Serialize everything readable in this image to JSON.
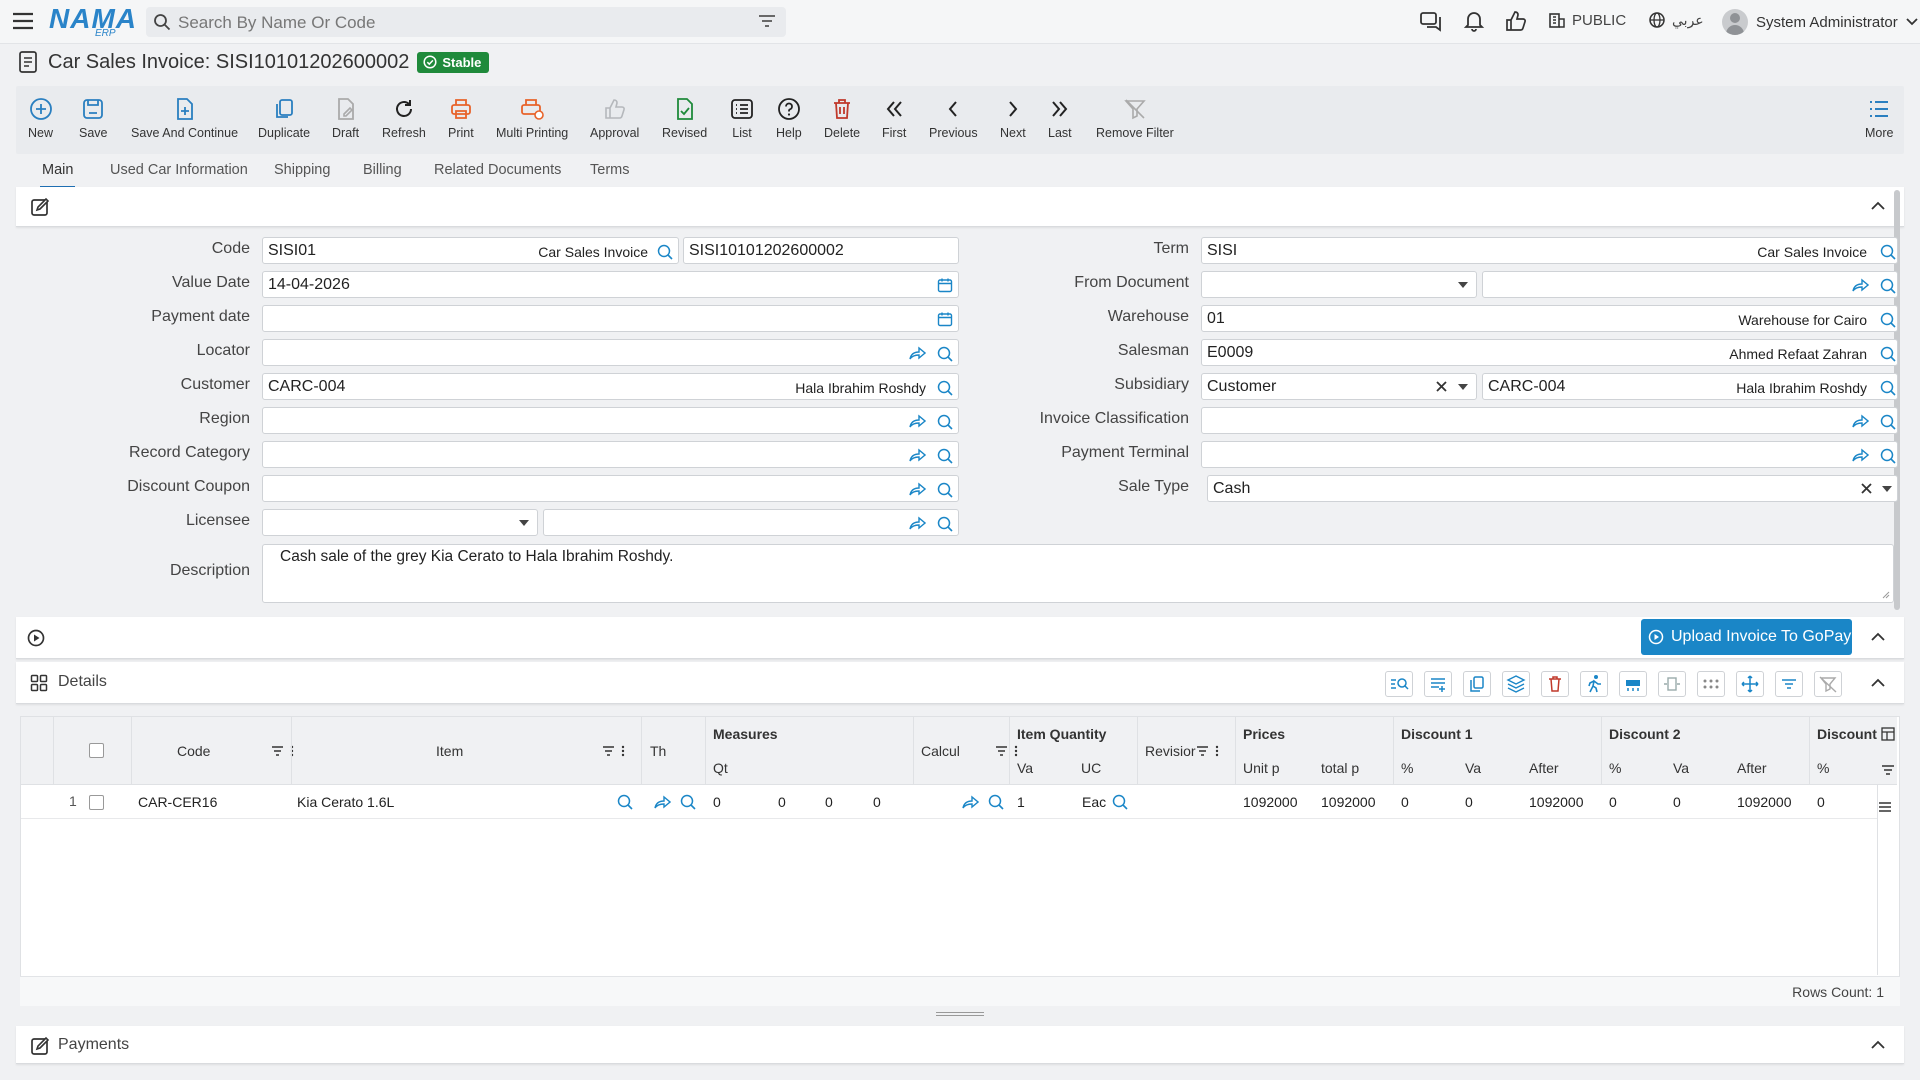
{
  "topbar": {
    "logo_main": "NAMA",
    "logo_sub": "ERP",
    "search_placeholder": "Search By Name Or Code",
    "public_label": "PUBLIC",
    "language_label": "عربي",
    "user_name": "System Administrator"
  },
  "page": {
    "title": "Car Sales Invoice: SISI10101202600002",
    "status": "Stable"
  },
  "toolbar": {
    "new": "New",
    "save": "Save",
    "save_continue": "Save And Continue",
    "duplicate": "Duplicate",
    "draft": "Draft",
    "refresh": "Refresh",
    "print": "Print",
    "multi_printing": "Multi Printing",
    "approval": "Approval",
    "revised": "Revised",
    "list": "List",
    "help": "Help",
    "delete": "Delete",
    "first": "First",
    "previous": "Previous",
    "next": "Next",
    "last": "Last",
    "remove_filter": "Remove Filter",
    "more": "More"
  },
  "tabs": [
    "Main",
    "Used Car Information",
    "Shipping",
    "Billing",
    "Related Documents",
    "Terms"
  ],
  "form": {
    "code": {
      "label": "Code",
      "value": "SISI01",
      "desc": "Car Sales Invoice",
      "number": "SISI10101202600002"
    },
    "value_date": {
      "label": "Value Date",
      "value": "14-04-2026"
    },
    "payment_date": {
      "label": "Payment date",
      "value": ""
    },
    "locator": {
      "label": "Locator",
      "value": ""
    },
    "customer": {
      "label": "Customer",
      "value": "CARC-004",
      "desc": "Hala Ibrahim Roshdy"
    },
    "region": {
      "label": "Region",
      "value": ""
    },
    "record_category": {
      "label": "Record Category",
      "value": ""
    },
    "discount_coupon": {
      "label": "Discount Coupon",
      "value": ""
    },
    "licensee": {
      "label": "Licensee",
      "value": ""
    },
    "description": {
      "label": "Description",
      "value": "Cash sale of the grey Kia Cerato to Hala Ibrahim Roshdy."
    },
    "term": {
      "label": "Term",
      "value": "SISI",
      "desc": "Car Sales Invoice"
    },
    "from_document": {
      "label": "From Document",
      "value": ""
    },
    "warehouse": {
      "label": "Warehouse",
      "value": "01",
      "desc": "Warehouse for Cairo"
    },
    "salesman": {
      "label": "Salesman",
      "value": "E0009",
      "desc": "Ahmed Refaat Zahran"
    },
    "subsidiary": {
      "label": "Subsidiary",
      "type": "Customer",
      "value": "CARC-004",
      "desc": "Hala Ibrahim Roshdy"
    },
    "invoice_classification": {
      "label": "Invoice Classification",
      "value": ""
    },
    "payment_terminal": {
      "label": "Payment Terminal",
      "value": ""
    },
    "sale_type": {
      "label": "Sale Type",
      "value": "Cash"
    }
  },
  "upload_button": "Upload Invoice To GoPay",
  "details": {
    "title": "Details",
    "groups": {
      "measures": "Measures",
      "item_quantity": "Item Quantity",
      "prices": "Prices",
      "discount1": "Discount 1",
      "discount2": "Discount 2",
      "discount3": "Discount"
    },
    "columns": {
      "code": "Code",
      "item": "Item",
      "th": "Th",
      "calcul": "Calcul",
      "revision": "Revisior",
      "qty": "Qt",
      "va": "Va",
      "uc": "UC",
      "unit": "Unit p",
      "total": "total p",
      "d1_pct": "%",
      "d1_va": "Va",
      "d1_after": "After",
      "d2_pct": "%",
      "d2_va": "Va",
      "d2_after": "After",
      "d3_pct": "%"
    },
    "rows": [
      {
        "num": "1",
        "code": "CAR-CER16",
        "item": "Kia Cerato 1.6L",
        "m1": "0",
        "m2": "0",
        "m3": "0",
        "m4": "0",
        "qty": "1",
        "uc": "Eac",
        "unit_price": "1092000",
        "total_price": "1092000",
        "d1_pct": "0",
        "d1_val": "0",
        "d1_after": "1092000",
        "d2_pct": "0",
        "d2_val": "0",
        "d2_after": "1092000",
        "d3_pct": "0"
      }
    ],
    "rows_count": "Rows Count: 1"
  },
  "payments": {
    "title": "Payments"
  },
  "colors": {
    "accent": "#1a86c7",
    "stable": "#1f8a3b",
    "delete": "#c0392b",
    "print": "#e8632a"
  }
}
